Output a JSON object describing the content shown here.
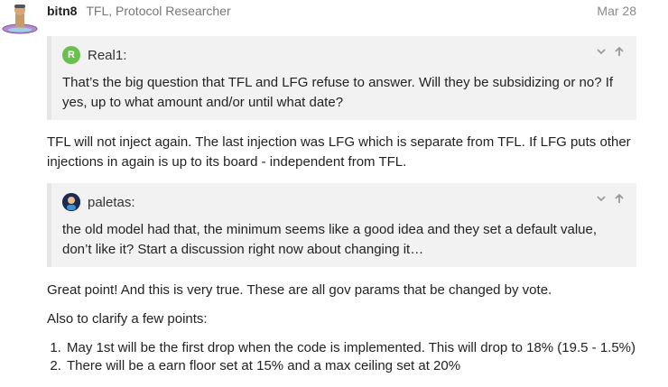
{
  "post": {
    "username": "bitn8",
    "user_title": "TFL, Protocol Researcher",
    "date": "Mar 28"
  },
  "quotes": [
    {
      "author": "Real1:",
      "avatar_letter": "R",
      "avatar_color": "#6bbf4e",
      "text": "That’s the big question that TFL and LFG refuse to answer. Will they be subsidizing or no? If yes, up to what amount and/or until what date?"
    },
    {
      "author": "paletas:",
      "avatar_color": "#2a3a6a",
      "text": "the old model had that, the minimum seems like a good idea and they set a default value, don’t like it? Start a discussion right now about changing it…"
    }
  ],
  "body": {
    "para1": "TFL will not inject again. The last injection was LFG which is separate from TFL. If LFG puts other injections in again is up to its board - independent from TFL.",
    "para2": "Great point! And this is very true. These are all gov params that be changed by vote.",
    "para3": "Also to clarify a few points:",
    "list": [
      "May 1st will be the first drop when the code is implemented. This will drop to 18% (19.5 - 1.5%)",
      "There will be a earn floor set at 15% and a max ceiling set at 20%"
    ]
  },
  "icons": {
    "expand": "chevron-down-icon",
    "jump": "arrow-up-icon"
  }
}
